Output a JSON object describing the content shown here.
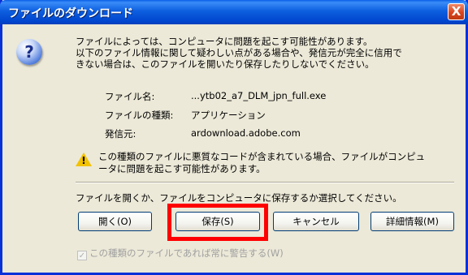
{
  "window": {
    "title": "ファイルのダウンロード",
    "close_glyph": "X"
  },
  "intro_text": {
    "line1": "ファイルによっては、コンピュータに問題を起こす可能性があります。",
    "line2": "以下のファイル情報に関して疑わしい点がある場合や、発信元が完全に信用で",
    "line3": "きない場合は、このファイルを開いたり保存したりしないでください。"
  },
  "file_info": [
    {
      "label": "ファイル名:",
      "value": "...ytb02_a7_DLM_jpn_full.exe"
    },
    {
      "label": "ファイルの種類:",
      "value": "アプリケーション"
    },
    {
      "label": "発信元:",
      "value": "ardownload.adobe.com"
    }
  ],
  "warning": {
    "line1": "この種類のファイルに悪質なコードが含まれている場合、ファイルがコンピュ",
    "line2": "ータに問題を起こす可能性があります。"
  },
  "prompt": "ファイルを開くか、ファイルをコンピュータに保存するか選択してください。",
  "buttons": {
    "open": "開く(O)",
    "save": "保存(S)",
    "cancel": "キャンセル",
    "details": "詳細情報(M)"
  },
  "checkbox": {
    "label": "この種類のファイルであれば常に警告する(W)",
    "checked_glyph": "✓"
  },
  "colors": {
    "highlight": "#ff0000",
    "titlebar": "#0a5fe6",
    "dialog_bg": "#ece9d8"
  }
}
